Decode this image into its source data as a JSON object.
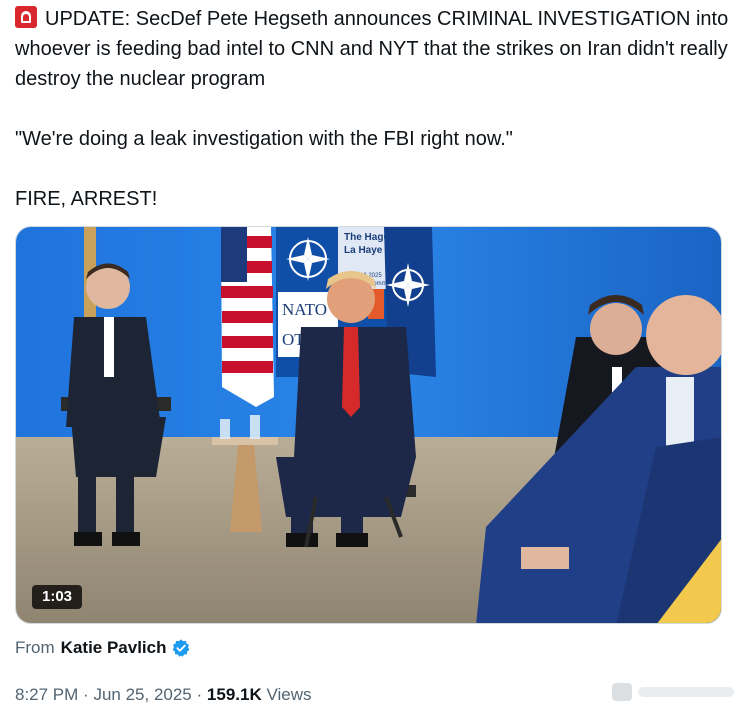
{
  "tweet": {
    "headline": "UPDATE: SecDef Pete Hegseth announces CRIMINAL INVESTIGATION into whoever is feeding bad intel to CNN and NYT that the strikes on Iran didn't really destroy the nuclear program",
    "quote": "\"We're doing a leak investigation with the FBI right now.\"",
    "closing": "FIRE, ARREST!",
    "leading_icon": "police-light-icon"
  },
  "media": {
    "duration": "1:03",
    "backdrop_text": {
      "nato_line1": "NATO",
      "nato_line2": "OTAN",
      "venue_line1": "The Hague",
      "venue_line2": "La Haye",
      "venue_dates": "24-25 VI 2025",
      "venue_sub": "Summit | Sommet"
    }
  },
  "attribution": {
    "from_label": "From",
    "author": "Katie Pavlich",
    "badge_icon": "verified-badge-icon",
    "badge_color": "#1d9bf0"
  },
  "meta": {
    "time": "8:27 PM",
    "separator": "·",
    "date": "Jun 25, 2025",
    "views_count": "159.1K",
    "views_label": "Views"
  },
  "colors": {
    "text": "#0f1419",
    "muted": "#536471",
    "siren": "#d8282e",
    "backdrop_blue": "#1d6fd6"
  }
}
